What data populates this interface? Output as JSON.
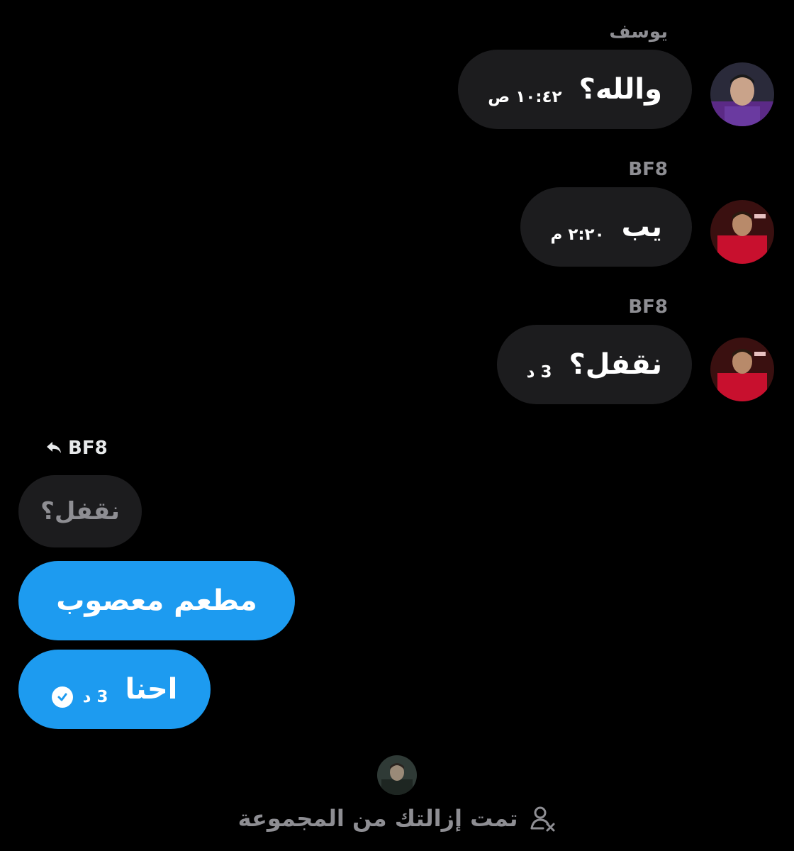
{
  "messages": [
    {
      "sender": "يوسف",
      "text": "والله؟",
      "time": "١٠:٤٢ ص"
    },
    {
      "sender": "BF8",
      "text": "يب",
      "time": "٢:٢٠ م"
    },
    {
      "sender": "BF8",
      "text": "نقفل؟",
      "time": "3 د"
    }
  ],
  "reply": {
    "to_label": "BF8",
    "quoted_text": "نقفل؟"
  },
  "outgoing": [
    {
      "text": "مطعم معصوب"
    },
    {
      "text": "احنا",
      "time": "3 د",
      "status": "sent-check-icon"
    }
  ],
  "system": {
    "text": "تمت إزالتك من المجموعة",
    "icon": "user-removed-icon"
  },
  "colors": {
    "background": "#000000",
    "received_bubble": "#1c1c1e",
    "sent_bubble": "#1d9bf0",
    "muted_text": "#8e8e93"
  }
}
